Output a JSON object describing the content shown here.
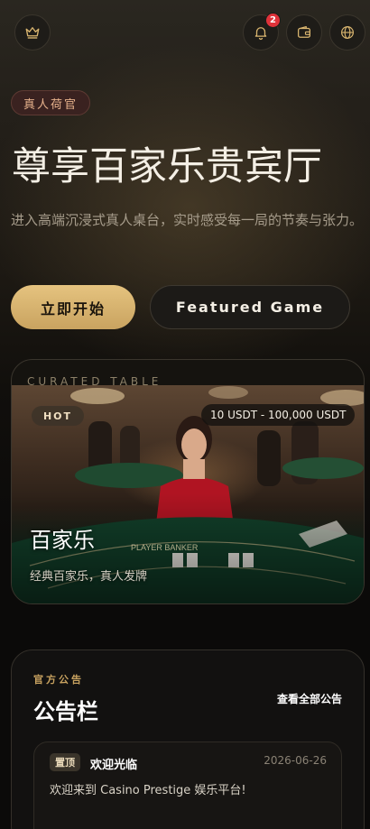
{
  "topbar": {
    "logo_icon": "crown-icon",
    "notification_icon": "bell-icon",
    "notification_count": "2",
    "wallet_icon": "wallet-icon",
    "language_icon": "globe-icon"
  },
  "hero": {
    "tag": "真人荷官",
    "title": "尊享百家乐贵宾厅",
    "subtitle": "进入高端沉浸式真人桌台，实时感受每一局的节奏与张力。",
    "primary_button": "立即开始",
    "secondary_button": "Featured Game"
  },
  "featured": {
    "eyebrow": "CURATED TABLE",
    "hot_label": "HOT",
    "bet_range": "10 USDT - 100,000 USDT",
    "game_name": "百家乐",
    "game_desc": "经典百家乐，真人发牌",
    "table_text": "PLAYER  BANKER"
  },
  "notices": {
    "eyebrow": "官方公告",
    "title": "公告栏",
    "view_all": "查看全部公告",
    "items": [
      {
        "pin": "置顶",
        "title": "欢迎光临",
        "date": "2026-06-26",
        "body": "欢迎来到 Casino Prestige 娱乐平台!"
      }
    ]
  },
  "colors": {
    "accent_gold": "#d9b56f",
    "badge_red": "#e0323a",
    "background": "#0b0a09"
  }
}
